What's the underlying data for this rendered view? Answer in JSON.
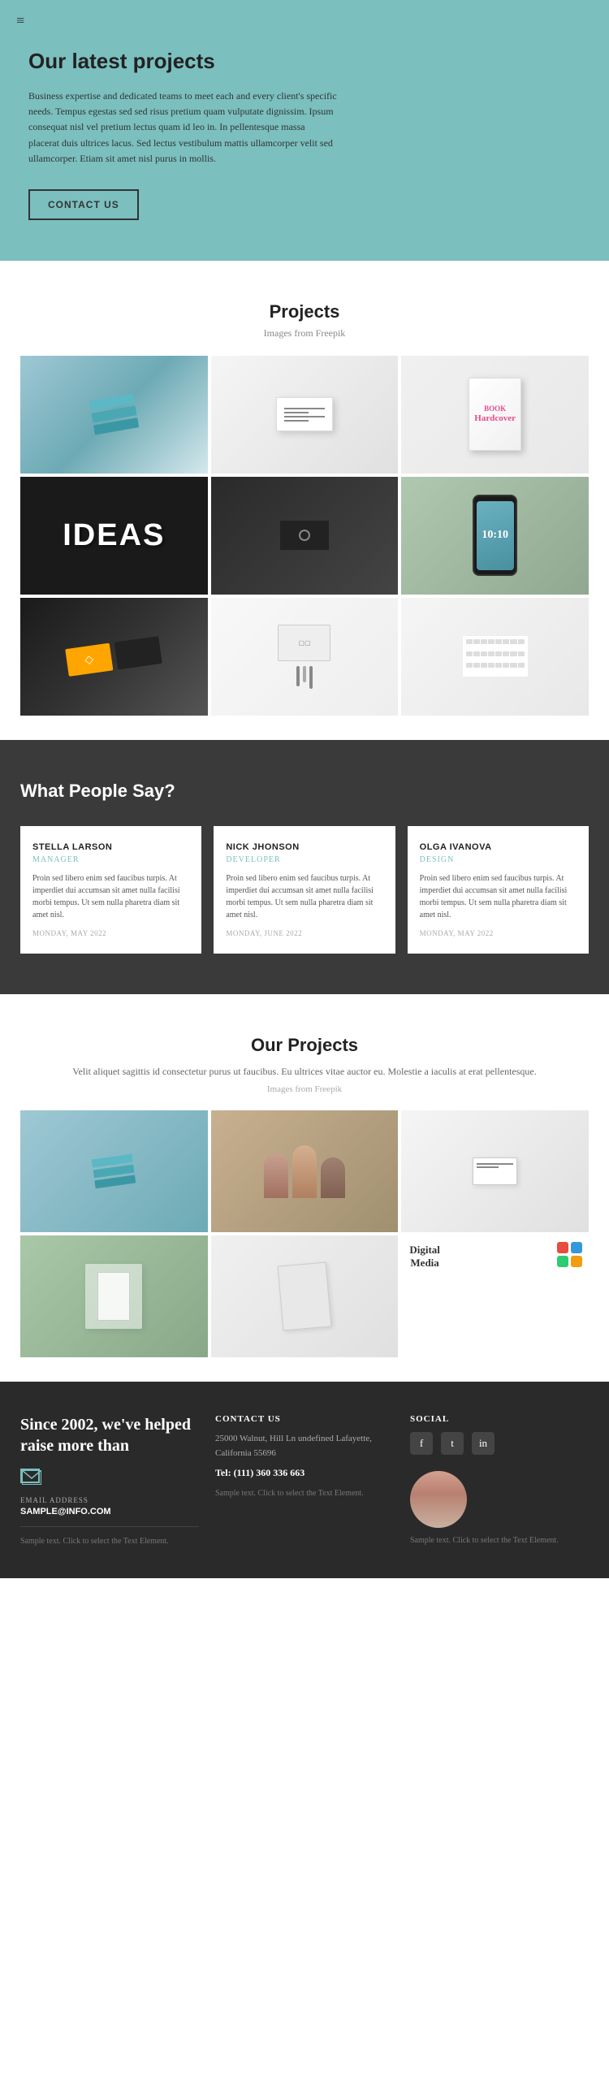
{
  "hero": {
    "title": "Our latest projects",
    "description": "Business expertise and dedicated teams to meet each and every client's specific needs. Tempus egestas sed sed risus pretium quam vulputate dignissim. Ipsum consequat nisl vel pretium lectus quam id leo in. In pellentesque massa placerat duis ultrices lacus. Sed lectus vestibulum mattis ullamcorper velit sed ullamcorper. Etiam sit amet nisl purus in mollis.",
    "contact_btn": "CONTACT US",
    "hamburger": "≡"
  },
  "projects_section": {
    "title": "Projects",
    "subtitle": "Images from Freepik"
  },
  "testimonials": {
    "title": "What People Say?",
    "cards": [
      {
        "name": "STELLA LARSON",
        "role": "MANAGER",
        "text": "Proin sed libero enim sed faucibus turpis. At imperdiet dui accumsan sit amet nulla facilisi morbi tempus. Ut sem nulla pharetra diam sit amet nisl.",
        "date": "MONDAY, MAY 2022"
      },
      {
        "name": "NICK JHONSON",
        "role": "DEVELOPER",
        "text": "Proin sed libero enim sed faucibus turpis. At imperdiet dui accumsan sit amet nulla facilisi morbi tempus. Ut sem nulla pharetra diam sit amet nisl.",
        "date": "MONDAY, JUNE 2022"
      },
      {
        "name": "OLGA IVANOVA",
        "role": "DESIGN",
        "text": "Proin sed libero enim sed faucibus turpis. At imperdiet dui accumsan sit amet nulla facilisi morbi tempus. Ut sem nulla pharetra diam sit amet nisl.",
        "date": "MONDAY, MAY 2022"
      }
    ]
  },
  "our_projects": {
    "title": "Our Projects",
    "desc": "Velit aliquet sagittis id consectetur purus ut faucibus. Eu ultrices vitae auctor eu. Molestie a iaculis at erat pellentesque.",
    "img_credit": "Images from\nFreepik"
  },
  "footer": {
    "since_text": "Since 2002, we've helped raise more than",
    "email_label": "EMAIL ADDRESS",
    "email": "SAMPLE@INFO.COM",
    "small_text": "Sample text. Click to select the Text Element.",
    "contact": {
      "label": "CONTACT US",
      "address": "25000 Walnut,\nHill Ln undefined Lafayette,\nCalifornia 55696",
      "tel_label": "Tel:",
      "tel": "(111) 360 336 663",
      "sample_text": "Sample text. Click to select\nthe Text Element."
    },
    "social": {
      "label": "SOCIAL",
      "icons": [
        "f",
        "t",
        "in"
      ],
      "bottom_text": "Sample text. Click to select the Text Element."
    }
  }
}
